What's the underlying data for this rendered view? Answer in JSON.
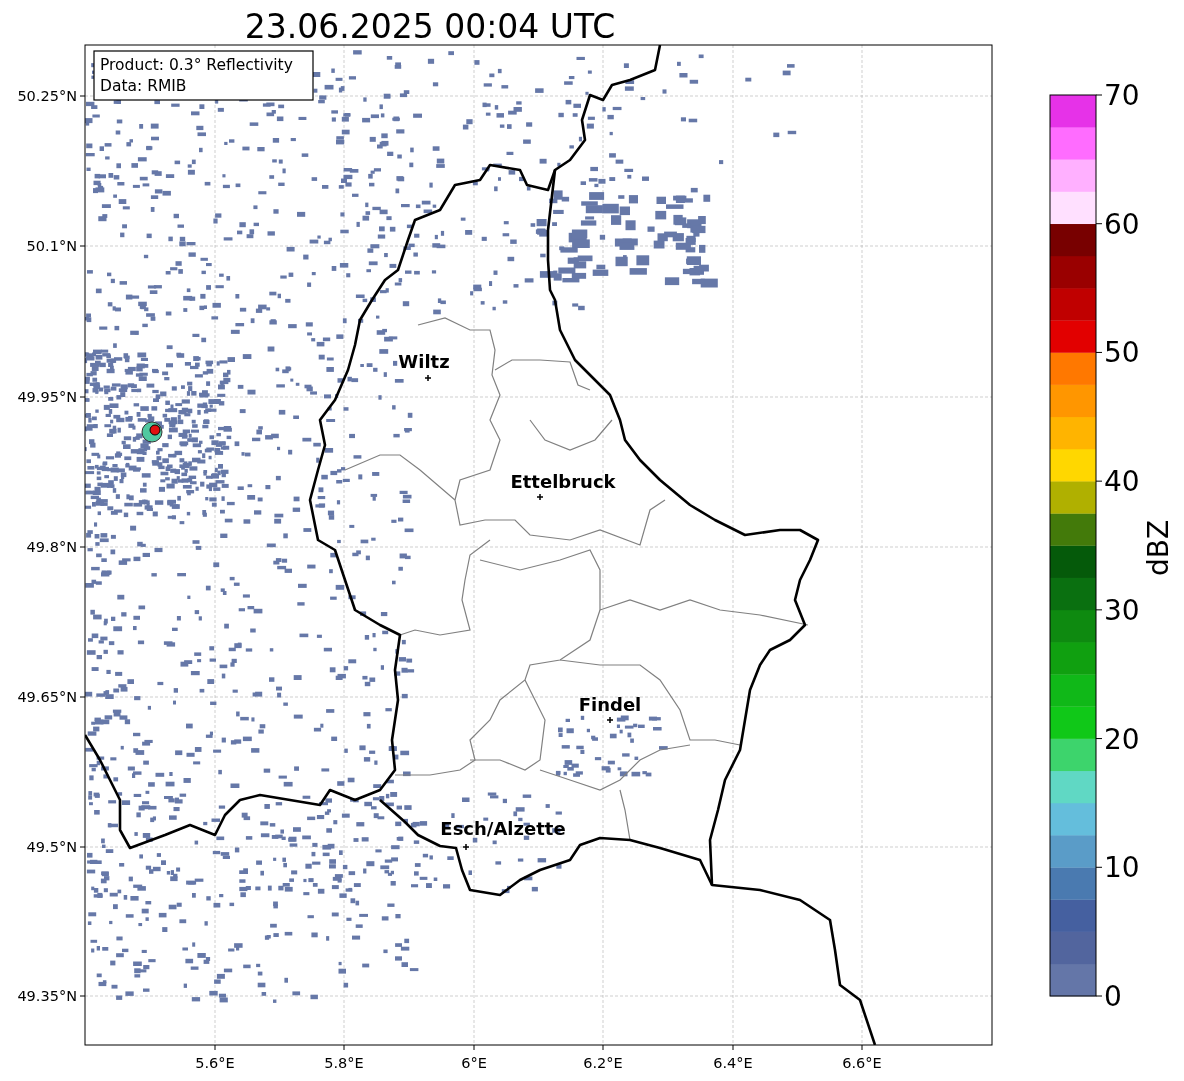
{
  "title": "23.06.2025 00:04 UTC",
  "info_box": [
    "Product: 0.3° Reflectivity",
    "Data: RMIB"
  ],
  "map": {
    "y_ticks": [
      "50.25°N",
      "50.1°N",
      "49.95°N",
      "49.8°N",
      "49.65°N",
      "49.5°N",
      "49.35°N"
    ],
    "x_ticks": [
      "5.6°E",
      "5.8°E",
      "6°E",
      "6.2°E",
      "6.4°E",
      "6.6°E"
    ],
    "cities": [
      {
        "name": "Wiltz"
      },
      {
        "name": "Ettelbruck"
      },
      {
        "name": "Findel"
      },
      {
        "name": "Esch/Alzette"
      }
    ]
  },
  "colorbar": {
    "label": "dBZ",
    "ticks": [
      "70",
      "60",
      "50",
      "40",
      "30",
      "20",
      "10",
      "0"
    ],
    "bins": [
      {
        "color": "#6476a8"
      },
      {
        "color": "#52659e"
      },
      {
        "color": "#4560a0"
      },
      {
        "color": "#4a7ab0"
      },
      {
        "color": "#5a9cc8"
      },
      {
        "color": "#64bedc"
      },
      {
        "color": "#60d8c4"
      },
      {
        "color": "#3dd46c"
      },
      {
        "color": "#10c818"
      },
      {
        "color": "#10b818"
      },
      {
        "color": "#10a010"
      },
      {
        "color": "#0e8a10"
      },
      {
        "color": "#0a7010"
      },
      {
        "color": "#055a0a"
      },
      {
        "color": "#437a0a"
      },
      {
        "color": "#b0b000"
      },
      {
        "color": "#ffd700"
      },
      {
        "color": "#ffb400"
      },
      {
        "color": "#ff9600"
      },
      {
        "color": "#ff7800"
      },
      {
        "color": "#e20000"
      },
      {
        "color": "#c00000"
      },
      {
        "color": "#9a0000"
      },
      {
        "color": "#780000"
      },
      {
        "color": "#ffe0ff"
      },
      {
        "color": "#ffb0ff"
      },
      {
        "color": "#ff6cff"
      },
      {
        "color": "#e632e8"
      }
    ]
  }
}
